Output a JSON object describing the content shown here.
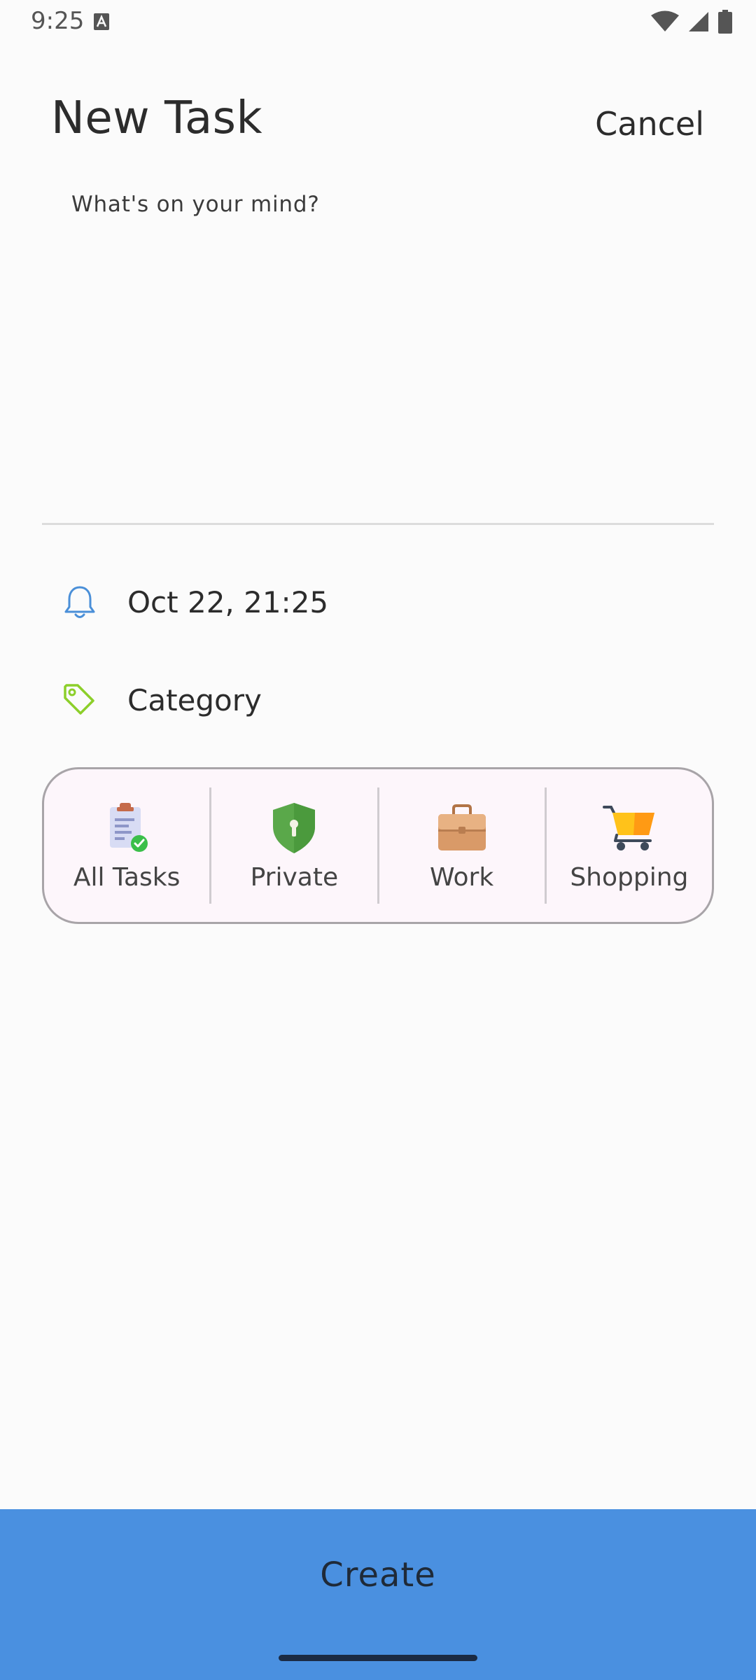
{
  "status_bar": {
    "time": "9:25",
    "icons": [
      "keyboard-a-icon",
      "wifi-icon",
      "signal-icon",
      "battery-icon"
    ]
  },
  "header": {
    "title": "New Task",
    "cancel_label": "Cancel"
  },
  "task_input": {
    "placeholder": "What's on your mind?",
    "value": ""
  },
  "reminder": {
    "icon": "bell-icon",
    "label": "Oct 22, 21:25",
    "icon_color": "#4a8fd8"
  },
  "category": {
    "icon": "tag-icon",
    "label": "Category",
    "icon_color": "#8ccf2a"
  },
  "categories": [
    {
      "label": "All Tasks",
      "icon": "clipboard-check-icon"
    },
    {
      "label": "Private",
      "icon": "shield-lock-icon"
    },
    {
      "label": "Work",
      "icon": "briefcase-icon"
    },
    {
      "label": "Shopping",
      "icon": "shopping-cart-icon"
    }
  ],
  "footer": {
    "create_label": "Create",
    "button_color": "#4a90e0"
  }
}
